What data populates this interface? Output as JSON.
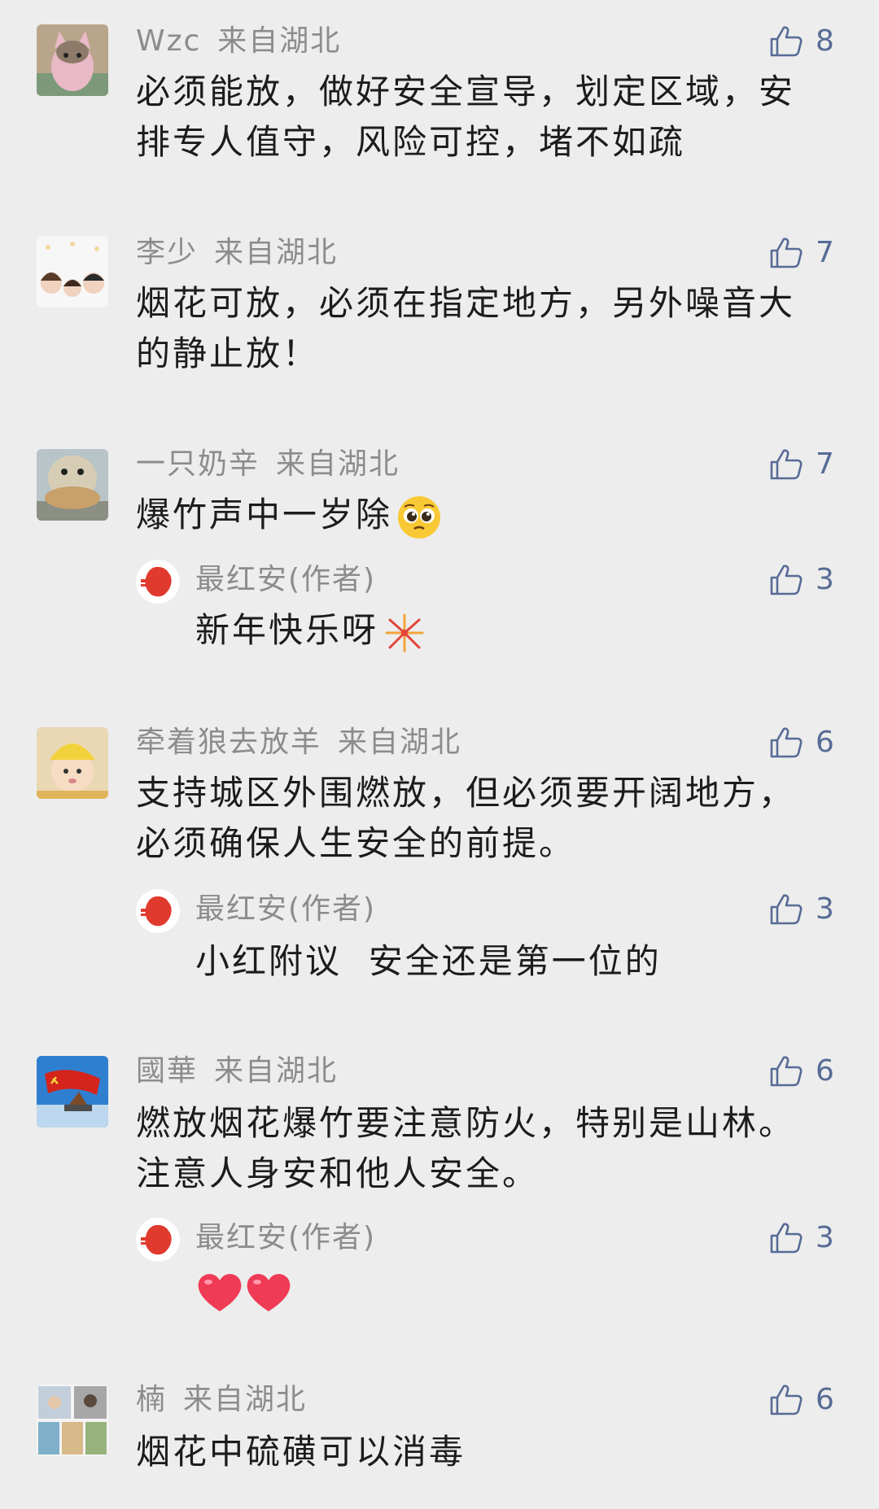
{
  "comments": [
    {
      "name": "Wzc",
      "location": "来自湖北",
      "text": "必须能放，做好安全宣导，划定区域，安排专人值守，风险可控，堵不如疏",
      "likes": "8",
      "avatar": "cat-avatar"
    },
    {
      "name": "李少",
      "location": "来自湖北",
      "text": "烟花可放，必须在指定地方，另外噪音大的静止放！",
      "likes": "7",
      "avatar": "cartoon-family-avatar"
    },
    {
      "name": "一只奶辛",
      "location": "来自湖北",
      "text": "爆竹声中一岁除",
      "emoji": "pleading-face-emoji",
      "likes": "7",
      "avatar": "duck-toy-avatar",
      "reply": {
        "name": "最红安(作者)",
        "text": "新年快乐呀",
        "emoji": "fireworks-emoji",
        "likes": "3"
      }
    },
    {
      "name": "牵着狼去放羊",
      "location": "来自湖北",
      "text": "支持城区外围燃放，但必须要开阔地方，必须确保人生安全的前提。",
      "likes": "6",
      "avatar": "baby-avatar",
      "reply": {
        "name": "最红安(作者)",
        "text": "小红附议  安全还是第一位的",
        "likes": "3"
      }
    },
    {
      "name": "國華",
      "location": "来自湖北",
      "text": "燃放烟花爆竹要注意防火，特别是山林。注意人身安和他人安全。",
      "likes": "6",
      "avatar": "red-flag-avatar",
      "reply": {
        "name": "最红安(作者)",
        "text": "",
        "emoji": "two-hearts-emoji",
        "likes": "3"
      }
    },
    {
      "name": "楠",
      "location": "来自湖北",
      "text": "烟花中硫磺可以消毒",
      "likes": "6",
      "avatar": "photo-collage-avatar"
    }
  ],
  "colors": {
    "background": "#ededed",
    "meta": "#8c8c8c",
    "text": "#1c1c1c",
    "like": "#576b95"
  }
}
